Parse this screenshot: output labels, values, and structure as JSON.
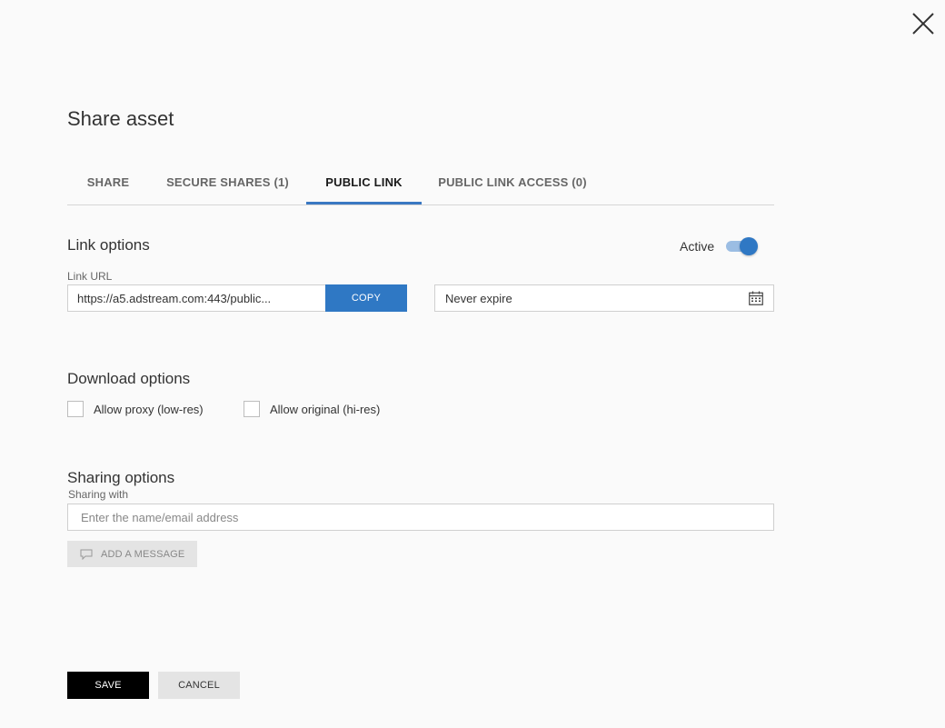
{
  "dialog": {
    "title": "Share asset"
  },
  "tabs": [
    {
      "label": "SHARE"
    },
    {
      "label": "SECURE SHARES (1)"
    },
    {
      "label": "PUBLIC LINK"
    },
    {
      "label": "PUBLIC LINK ACCESS (0)"
    }
  ],
  "active_tab": "PUBLIC LINK",
  "link_options": {
    "title": "Link options",
    "active_label": "Active",
    "active": true,
    "url_label": "Link URL",
    "url_value": "https://a5.adstream.com:443/public...",
    "copy_label": "COPY",
    "expire_value": "Never expire"
  },
  "download_options": {
    "title": "Download options",
    "proxy_label": "Allow proxy (low-res)",
    "proxy_checked": false,
    "original_label": "Allow original (hi-res)",
    "original_checked": false
  },
  "sharing_options": {
    "title": "Sharing options",
    "with_label": "Sharing with",
    "input_placeholder": "Enter the name/email address",
    "add_message_label": "ADD A MESSAGE"
  },
  "footer": {
    "save_label": "SAVE",
    "cancel_label": "CANCEL"
  },
  "colors": {
    "accent": "#2f78c4",
    "toggle_track": "#9bbde3",
    "save_button": "#000000",
    "secondary_button": "#e4e4e4"
  },
  "icons": {
    "close": "close-icon",
    "calendar": "calendar-icon",
    "message": "speech-bubble-icon"
  }
}
